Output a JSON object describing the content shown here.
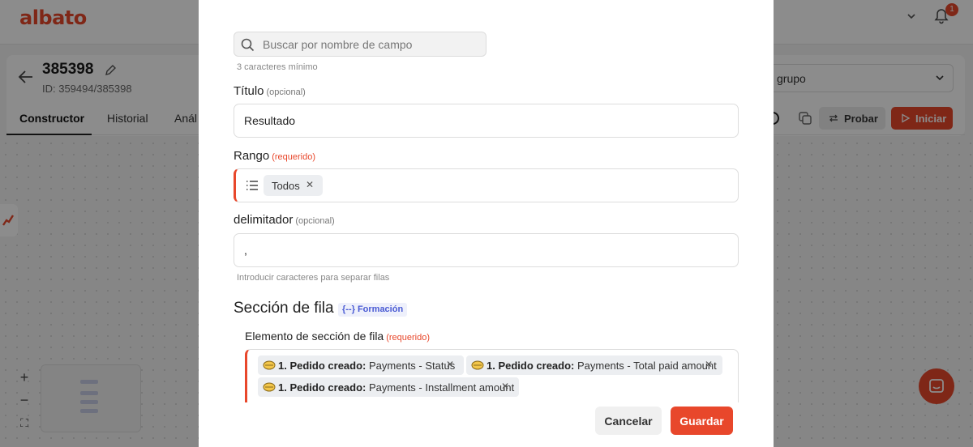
{
  "app": {
    "logo": "albato",
    "notification_count": "1",
    "flow": {
      "name": "385398",
      "id_text": "ID: 359494/385398"
    },
    "tabs": [
      "Constructor",
      "Historial",
      "Anál"
    ],
    "group_select": "grupo",
    "actions": {
      "test_label": "Probar",
      "start_label": "Iniciar"
    },
    "colors": {
      "brand": "#e8472b",
      "badge": "#4a5bd4"
    }
  },
  "modal": {
    "search": {
      "placeholder": "Buscar por nombre de campo",
      "value": "",
      "hint": "3 caracteres mínimo"
    },
    "title_field": {
      "label": "Título",
      "tag": "(opcional)",
      "value": "Resultado"
    },
    "range_field": {
      "label": "Rango",
      "tag": "(requerido)",
      "chip": "Todos"
    },
    "delimiter_field": {
      "label": "delimitador",
      "tag": "(opcional)",
      "value": ",",
      "hint": "Introducir caracteres para separar filas"
    },
    "row_section": {
      "title": "Sección de fila",
      "badge": "{--} Formación",
      "element_label": "Elemento de sección de fila",
      "element_tag": "(requerido)",
      "chips": [
        {
          "source": "1. Pedido creado:",
          "field": "Payments - Status"
        },
        {
          "source": "1. Pedido creado:",
          "field": "Payments - Total paid amount"
        },
        {
          "source": "1. Pedido creado:",
          "field": "Payments - Installment amount"
        }
      ]
    },
    "buttons": {
      "cancel": "Cancelar",
      "save": "Guardar"
    }
  }
}
